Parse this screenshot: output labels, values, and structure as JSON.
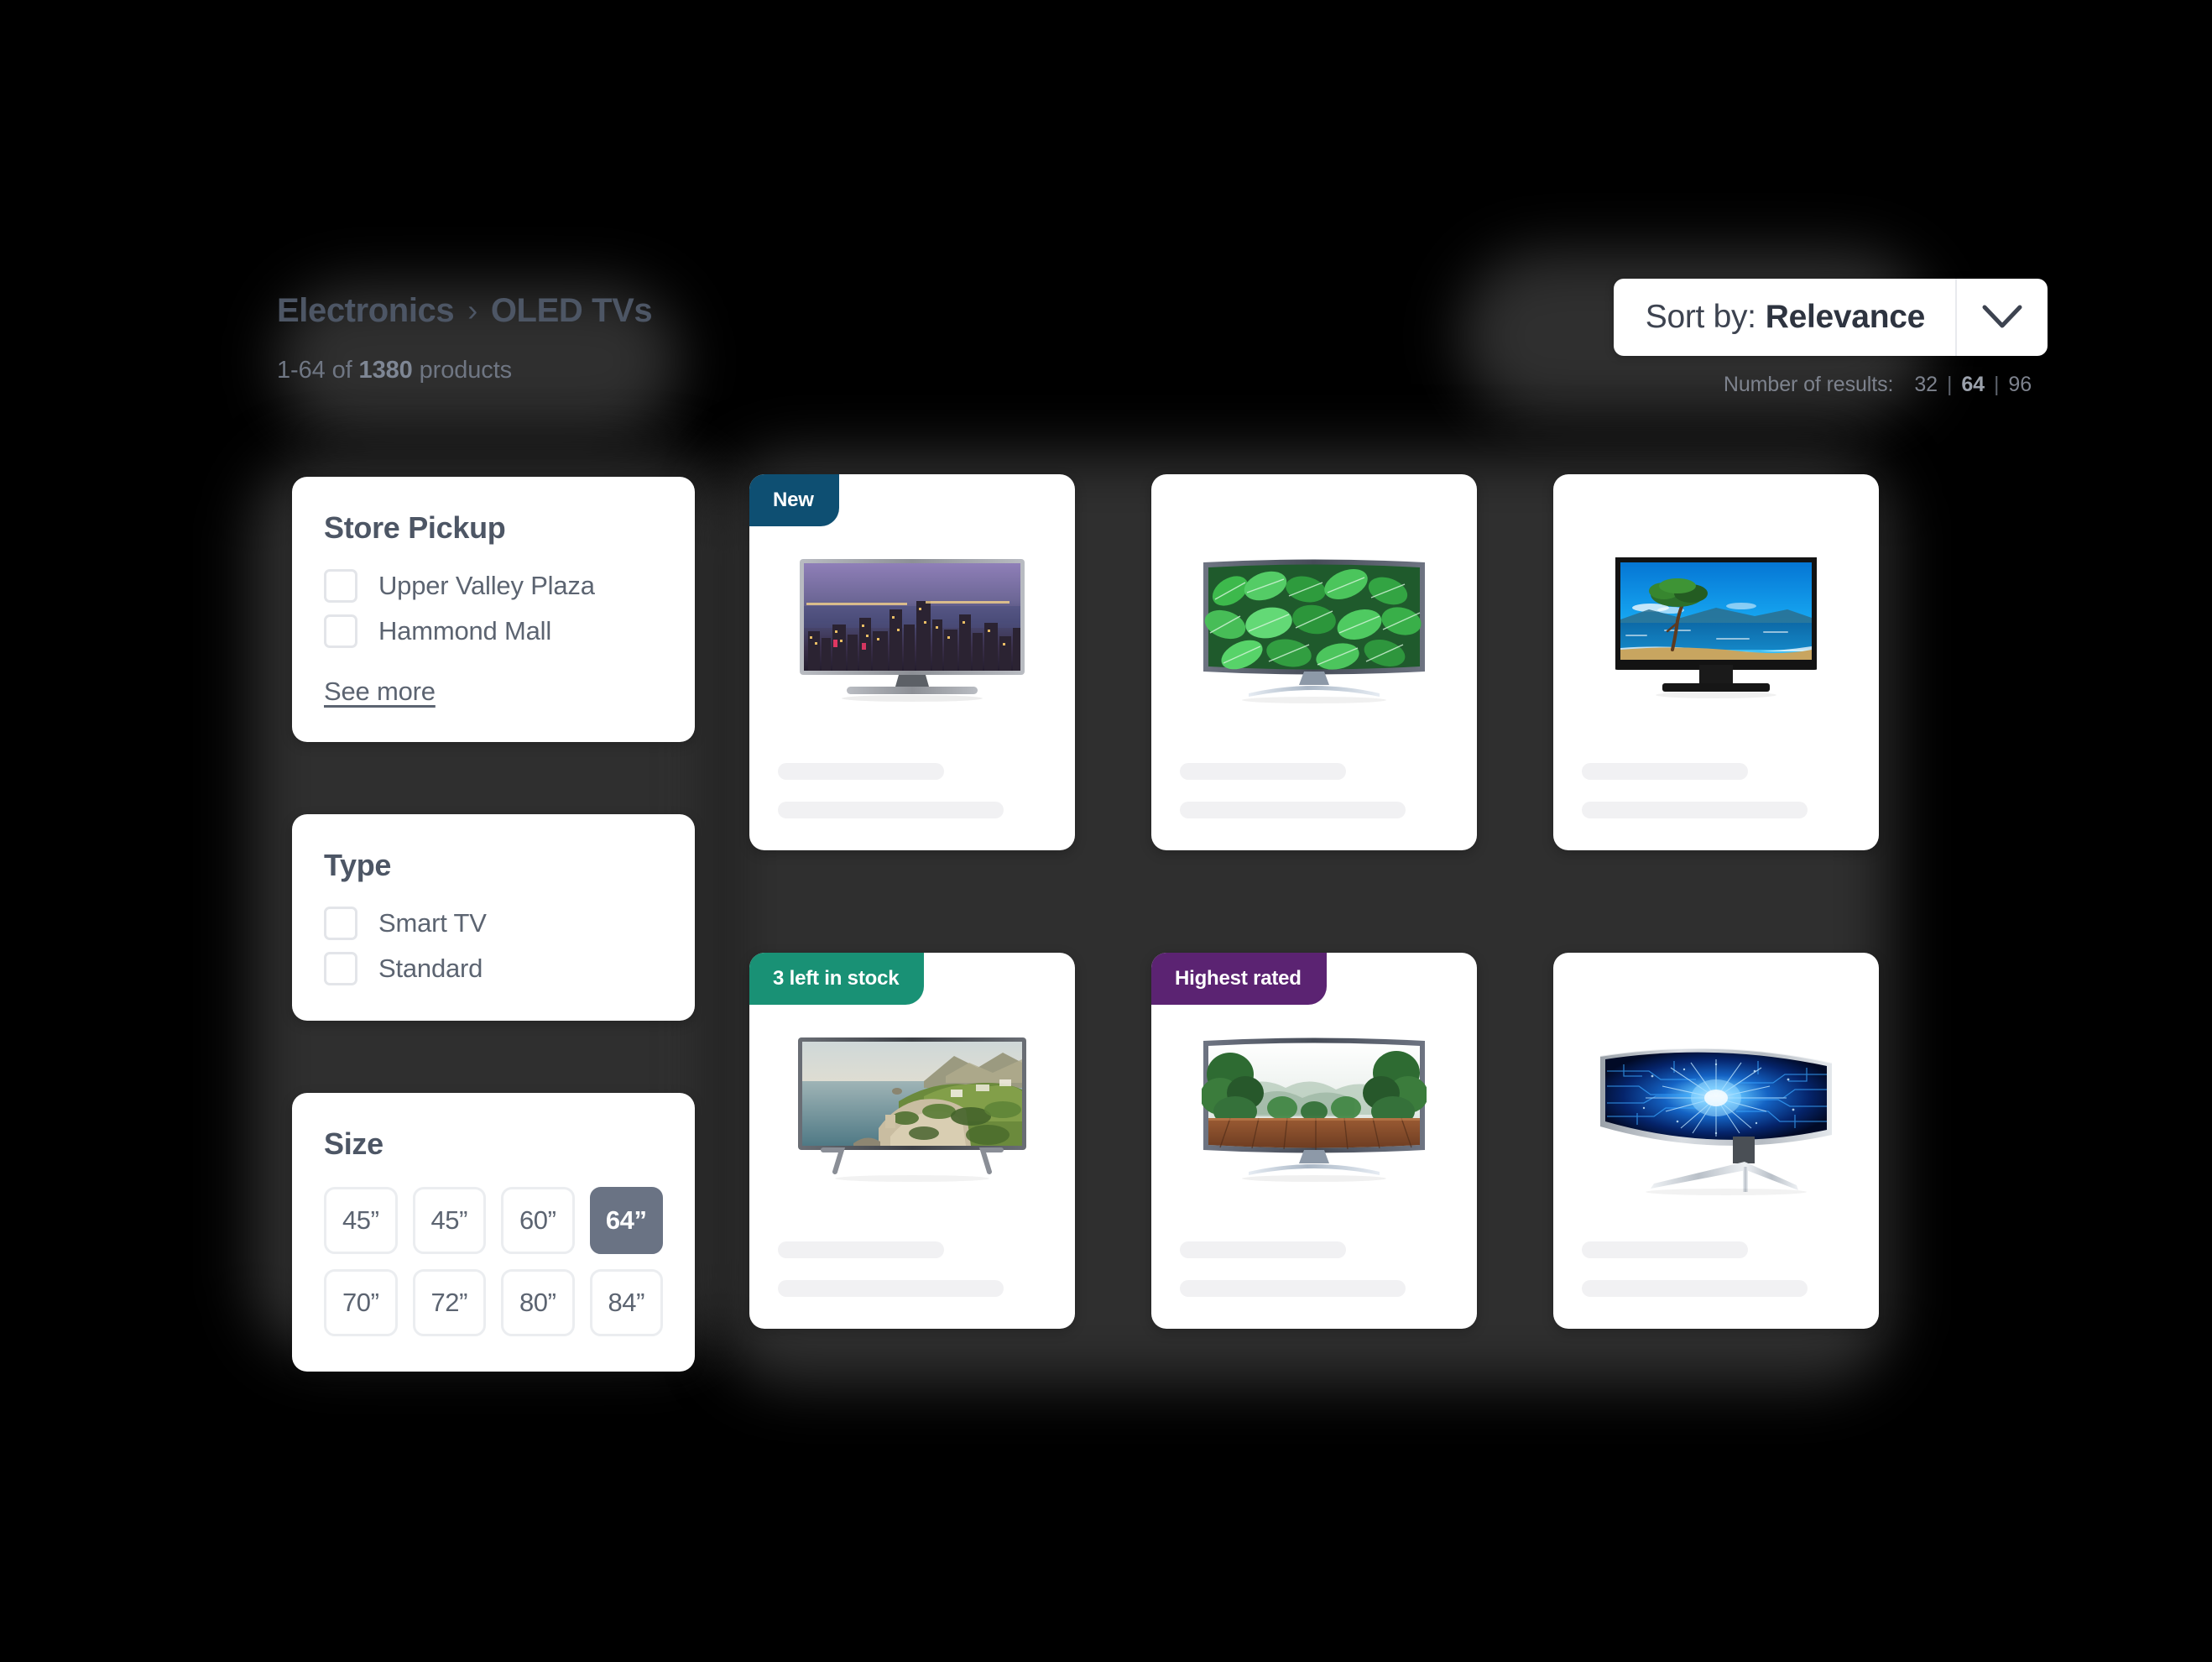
{
  "header": {
    "breadcrumb": {
      "root": "Electronics",
      "separator": "chevron-right-icon",
      "current": "OLED TVs"
    },
    "results_summary": {
      "range": "1-64 of ",
      "count": "1380",
      "suffix": " products"
    }
  },
  "sort": {
    "label": "Sort by:",
    "value": "Relevance",
    "chevron": "chevron-down-icon",
    "options": [
      "Relevance"
    ]
  },
  "number_of_results": {
    "label": "Number of results:",
    "options": [
      "32",
      "64",
      "96"
    ],
    "selected": "64",
    "separator": "|"
  },
  "filters": [
    {
      "id": "store-pickup",
      "title": "Store Pickup",
      "type": "checkbox",
      "items": [
        {
          "label": "Upper Valley Plaza",
          "checked": false
        },
        {
          "label": "Hammond Mall",
          "checked": false
        }
      ],
      "see_more": "See more"
    },
    {
      "id": "type",
      "title": "Type",
      "type": "checkbox",
      "items": [
        {
          "label": "Smart TV",
          "checked": false
        },
        {
          "label": "Standard",
          "checked": false
        }
      ]
    },
    {
      "id": "size",
      "title": "Size",
      "type": "chips",
      "chips": [
        {
          "label": "45”",
          "selected": false
        },
        {
          "label": "45”",
          "selected": false
        },
        {
          "label": "60”",
          "selected": false
        },
        {
          "label": "64”",
          "selected": true
        },
        {
          "label": "70”",
          "selected": false
        },
        {
          "label": "72”",
          "selected": false
        },
        {
          "label": "80”",
          "selected": false
        },
        {
          "label": "84”",
          "selected": false
        }
      ]
    }
  ],
  "products": [
    {
      "id": "p1",
      "badge": "New",
      "badge_color": "#0e4f72",
      "image": "curved-tv-city-skyline-night"
    },
    {
      "id": "p2",
      "badge": null,
      "badge_color": null,
      "image": "curved-tv-green-tropical-leaves"
    },
    {
      "id": "p3",
      "badge": null,
      "badge_color": null,
      "image": "flat-tv-lone-tree-beach"
    },
    {
      "id": "p4",
      "badge": "3 left in stock",
      "badge_color": "#199175",
      "image": "flat-tv-coastal-cliff"
    },
    {
      "id": "p5",
      "badge": "Highest rated",
      "badge_color": "#5b2372",
      "image": "curved-tv-misty-forest-deck"
    },
    {
      "id": "p6",
      "badge": null,
      "badge_color": null,
      "image": "ultrawide-curved-monitor-blue-circuit"
    }
  ],
  "colors": {
    "page_background": "#000000",
    "glow": "#2f2f2f",
    "card_background": "#ffffff",
    "text_muted": "#5c6471",
    "text_heading": "#4d5665",
    "chip_selected": "#6a7384",
    "skeleton": "#f1f1f3"
  }
}
